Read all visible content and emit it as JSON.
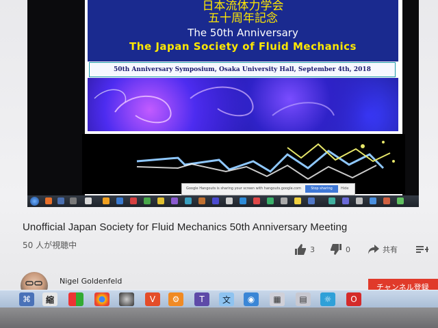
{
  "video": {
    "slide": {
      "jp_line1": "日本流体力学会",
      "jp_line2": "五十周年記念",
      "anniversary": "The 50th Anniversary",
      "society": "The Japan Society of Fluid Mechanics",
      "symposium": "50th Anniversary Symposium, Osaka University Hall, September 4th, 2018"
    },
    "hangouts_bar": {
      "message": "Google Hangouts is sharing your screen with hangouts.google.com",
      "stop_label": "Stop sharing",
      "hide_label": "Hide"
    }
  },
  "page": {
    "title": "Unofficial Japan Society for Fluid Mechanics 50th Anniversary Meeting",
    "viewers": "50 人が視聴中",
    "likes": "3",
    "dislikes": "0",
    "share_label": "共有",
    "add_label": "+",
    "channel_name": "Nigel Goldenfeld",
    "subscribe_label": "チャンネル登録"
  },
  "taskbar": {
    "kanji_icon": "縮"
  },
  "colors": {
    "slide_banner": "#1a2a8f",
    "accent_yellow": "#ffe800",
    "subscribe_red": "#e03a2a",
    "stop_blue": "#3f78d6"
  }
}
